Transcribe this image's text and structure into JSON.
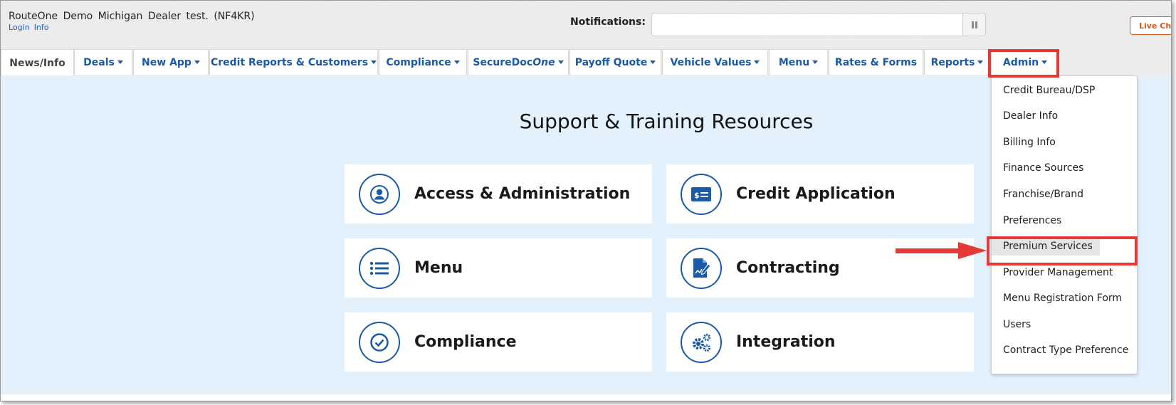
{
  "header": {
    "dealer_name": "RouteOne Demo Michigan Dealer test. (NF4KR)",
    "links": [
      "Login",
      "Info"
    ],
    "notifications_label": "Notifications:",
    "notifications_value": "",
    "live_chat": "Live Cha"
  },
  "nav": {
    "tabs": [
      {
        "label": "News/Info",
        "active": true
      },
      {
        "label": "Deals",
        "dropdown": true
      },
      {
        "label": "New App",
        "dropdown": true
      },
      {
        "label": "Credit Reports & Customers",
        "dropdown": true
      },
      {
        "label": "Compliance",
        "dropdown": true
      },
      {
        "label": "SecureDoc",
        "label_italic": "One",
        "dropdown": true
      },
      {
        "label": "Payoff Quote",
        "dropdown": true
      },
      {
        "label": "Vehicle Values",
        "dropdown": true
      },
      {
        "label": "Menu",
        "dropdown": true
      },
      {
        "label": "Rates & Forms"
      },
      {
        "label": "Reports",
        "dropdown": true
      },
      {
        "label": "Admin",
        "dropdown": true,
        "highlighted": true
      }
    ]
  },
  "main": {
    "title": "Support & Training Resources",
    "cards": [
      {
        "label": "Access & Administration",
        "icon": "user-icon"
      },
      {
        "label": "Credit Application",
        "icon": "credit-card-icon"
      },
      {
        "label": "Menu",
        "icon": "list-icon"
      },
      {
        "label": "Contracting",
        "icon": "document-sign-icon"
      },
      {
        "label": "Compliance",
        "icon": "check-circle-icon"
      },
      {
        "label": "Integration",
        "icon": "gears-icon"
      }
    ]
  },
  "admin_menu": {
    "items": [
      "Credit Bureau/DSP",
      "Dealer Info",
      "Billing Info",
      "Finance Sources",
      "Franchise/Brand",
      "Preferences",
      "Premium Services",
      "Provider Management",
      "Menu Registration Form",
      "Users",
      "Contract Type Preference"
    ],
    "highlighted_item": "Premium Services"
  },
  "colors": {
    "brand_blue": "#1a5aa6",
    "highlight_red": "#e53935",
    "main_bg": "#e3f1fd",
    "live_chat_orange": "#d45a1b"
  }
}
